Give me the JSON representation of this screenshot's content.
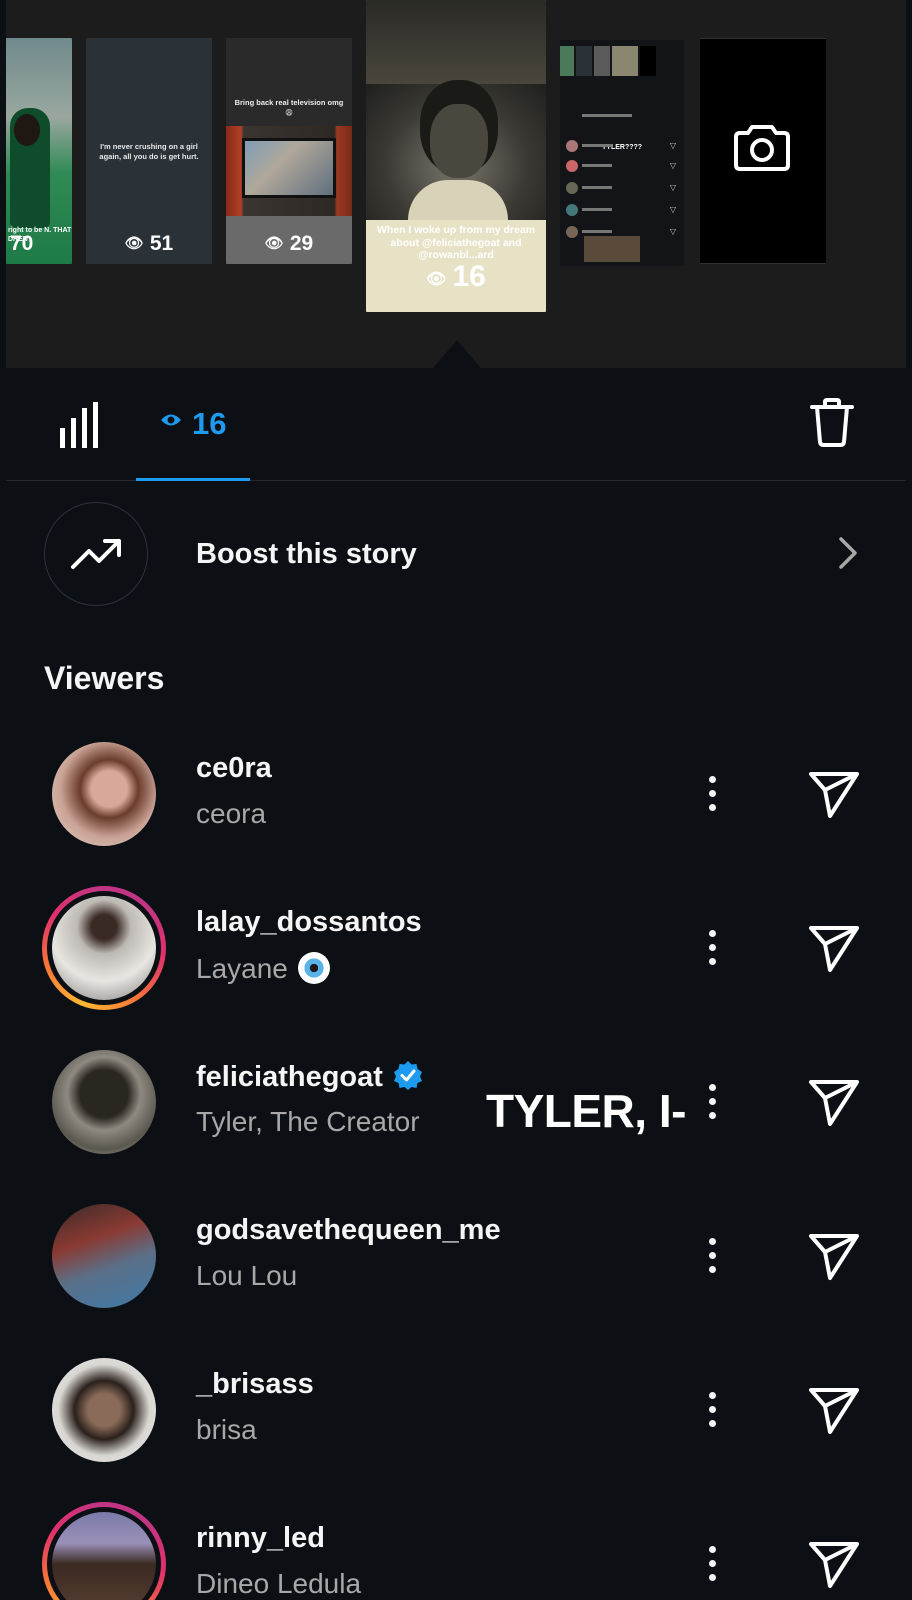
{
  "stories": [
    {
      "id": "story-1",
      "caption": "right to be\nN. THAT DREN",
      "views": "70"
    },
    {
      "id": "story-2",
      "caption": "I'm never crushing on a girl again, all you do is get hurt.",
      "views": "51"
    },
    {
      "id": "story-3",
      "caption": "Bring back real television omg 😩",
      "views": "29"
    },
    {
      "id": "story-4",
      "caption": "When I woke up from my dream about @feliciathegoat and @rowanbl...ard",
      "views": "16",
      "selected": true
    },
    {
      "id": "story-5",
      "caption": "TYLER????"
    },
    {
      "id": "story-6",
      "icon": "camera-icon"
    }
  ],
  "tabs": {
    "insights_icon": "bar-chart-icon",
    "viewers_count": "16",
    "delete_icon": "trash-icon"
  },
  "boost": {
    "label": "Boost this story",
    "icon": "trending-up-icon"
  },
  "viewers_title": "Viewers",
  "viewers": [
    {
      "username": "ce0ra",
      "fullname": "ceora",
      "ring": false
    },
    {
      "username": "lalay_dossantos",
      "fullname": "Layane",
      "emoji": "nazar-amulet",
      "ring": true
    },
    {
      "username": "feliciathegoat",
      "fullname": "Tyler, The Creator",
      "verified": true,
      "ring": false
    },
    {
      "username": "godsavethequeen_me",
      "fullname": "Lou Lou",
      "ring": false
    },
    {
      "username": "_brisass",
      "fullname": "brisa",
      "ring": false
    },
    {
      "username": "rinny_led",
      "fullname": "Dineo Ledula",
      "ring": true
    }
  ],
  "overlay_caption": "TYLER, I-",
  "colors": {
    "accent": "#1d9bf0",
    "background": "#0c1014",
    "secondary_text": "#a8a8a8"
  }
}
